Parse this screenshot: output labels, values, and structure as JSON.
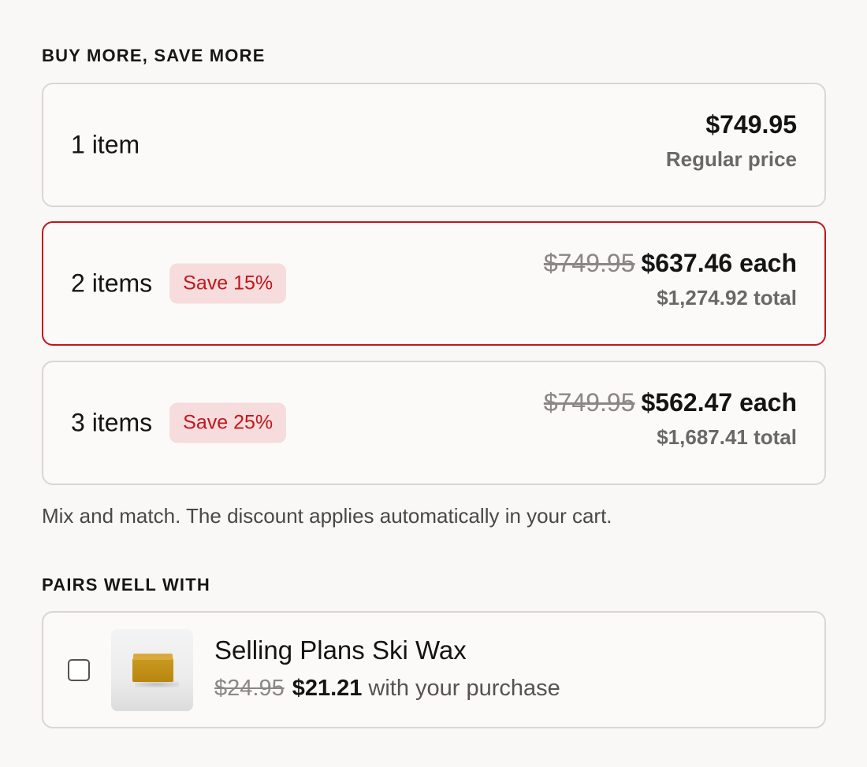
{
  "bundle": {
    "heading": "BUY MORE, SAVE MORE",
    "tiers": [
      {
        "quantity_label": "1 item",
        "badge": "",
        "compare_price": "",
        "price": "$749.95",
        "subtext": "Regular price",
        "selected": false
      },
      {
        "quantity_label": "2 items",
        "badge": "Save 15%",
        "compare_price": "$749.95",
        "price": "$637.46 each",
        "subtext": "$1,274.92 total",
        "selected": true
      },
      {
        "quantity_label": "3 items",
        "badge": "Save 25%",
        "compare_price": "$749.95",
        "price": "$562.47 each",
        "subtext": "$1,687.41 total",
        "selected": false
      }
    ],
    "note": "Mix and match. The discount applies automatically in your cart."
  },
  "pairs": {
    "heading": "PAIRS WELL WITH",
    "item": {
      "title": "Selling Plans Ski Wax",
      "compare_price": "$24.95",
      "price": "$21.21",
      "suffix": "with your purchase",
      "checked": false
    }
  },
  "colors": {
    "accent": "#c0171c",
    "badge_bg": "#f6dcdc",
    "border": "#d9d6d3",
    "background": "#f9f8f7"
  }
}
